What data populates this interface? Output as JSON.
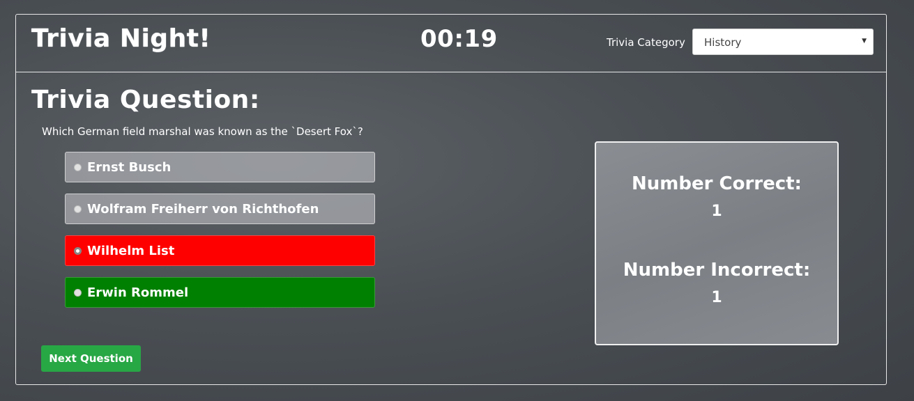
{
  "header": {
    "title": "Trivia Night!",
    "timer": "00:19",
    "category_label": "Trivia Category",
    "category_selected": "History"
  },
  "question": {
    "heading": "Trivia Question:",
    "text": "Which German field marshal was known as the `Desert Fox`?"
  },
  "answers": [
    {
      "label": "Ernst Busch",
      "state": "neutral"
    },
    {
      "label": "Wolfram Freiherr von Richthofen",
      "state": "neutral"
    },
    {
      "label": "Wilhelm List",
      "state": "wrong",
      "selected": true
    },
    {
      "label": "Erwin Rommel",
      "state": "correct"
    }
  ],
  "buttons": {
    "next_label": "Next Question"
  },
  "score": {
    "correct_label": "Number Correct:",
    "correct_value": "1",
    "incorrect_label": "Number Incorrect:",
    "incorrect_value": "1"
  },
  "colors": {
    "wrong": "#ff0000",
    "correct": "#008000",
    "next_button": "#28a745"
  }
}
